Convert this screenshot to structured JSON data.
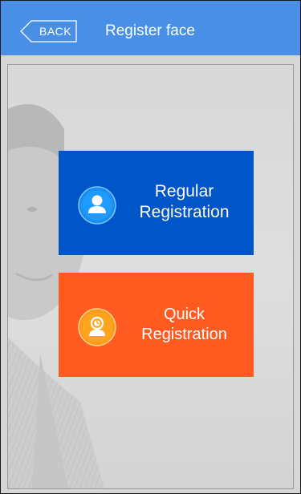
{
  "header": {
    "back_label": "BACK",
    "title": "Register face"
  },
  "options": [
    {
      "line1": "Regular",
      "line2": "Registration",
      "icon": "person-icon",
      "color": "#0055c8"
    },
    {
      "line1": "Quick",
      "line2": "Registration",
      "icon": "quick-person-icon",
      "color": "#ff5a1f"
    }
  ],
  "colors": {
    "header_bg": "#4a8fe6",
    "regular_tile": "#0055c8",
    "quick_tile": "#ff5a1f"
  }
}
